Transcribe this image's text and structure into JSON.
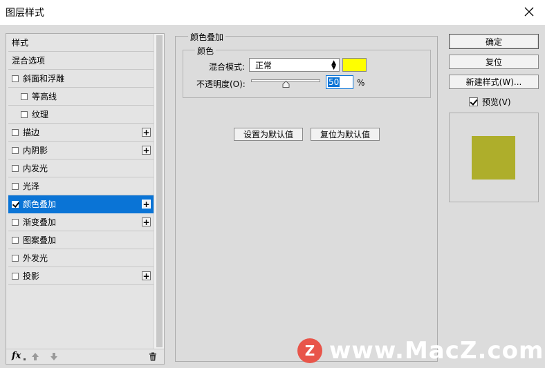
{
  "window": {
    "title": "图层样式"
  },
  "styles": {
    "items": [
      {
        "label": "样式",
        "checkbox": false,
        "checked": false,
        "plus": false,
        "indent": 0,
        "selected": false
      },
      {
        "label": "混合选项",
        "checkbox": false,
        "checked": false,
        "plus": false,
        "indent": 0,
        "selected": false
      },
      {
        "label": "斜面和浮雕",
        "checkbox": true,
        "checked": false,
        "plus": false,
        "indent": 0,
        "selected": false
      },
      {
        "label": "等高线",
        "checkbox": true,
        "checked": false,
        "plus": false,
        "indent": 1,
        "selected": false
      },
      {
        "label": "纹理",
        "checkbox": true,
        "checked": false,
        "plus": false,
        "indent": 1,
        "selected": false
      },
      {
        "label": "描边",
        "checkbox": true,
        "checked": false,
        "plus": true,
        "indent": 0,
        "selected": false
      },
      {
        "label": "内阴影",
        "checkbox": true,
        "checked": false,
        "plus": true,
        "indent": 0,
        "selected": false
      },
      {
        "label": "内发光",
        "checkbox": true,
        "checked": false,
        "plus": false,
        "indent": 0,
        "selected": false
      },
      {
        "label": "光泽",
        "checkbox": true,
        "checked": false,
        "plus": false,
        "indent": 0,
        "selected": false
      },
      {
        "label": "颜色叠加",
        "checkbox": true,
        "checked": true,
        "plus": true,
        "indent": 0,
        "selected": true
      },
      {
        "label": "渐变叠加",
        "checkbox": true,
        "checked": false,
        "plus": true,
        "indent": 0,
        "selected": false
      },
      {
        "label": "图案叠加",
        "checkbox": true,
        "checked": false,
        "plus": false,
        "indent": 0,
        "selected": false
      },
      {
        "label": "外发光",
        "checkbox": true,
        "checked": false,
        "plus": false,
        "indent": 0,
        "selected": false
      },
      {
        "label": "投影",
        "checkbox": true,
        "checked": false,
        "plus": true,
        "indent": 0,
        "selected": false
      }
    ],
    "footer_icons": [
      "fx-icon",
      "arrow-up-icon",
      "arrow-down-icon",
      "trash-icon"
    ],
    "fx_label": "fx"
  },
  "color_overlay": {
    "section_title": "颜色叠加",
    "group_title": "颜色",
    "blend_mode_label": "混合模式:",
    "blend_mode_value": "正常",
    "overlay_color": "#ffff00",
    "opacity_label": "不透明度(O):",
    "opacity_value": "50",
    "opacity_percent": 50,
    "opacity_unit": "%",
    "set_default_label": "设置为默认值",
    "reset_default_label": "复位为默认值"
  },
  "actions": {
    "ok_label": "确定",
    "reset_label": "复位",
    "new_style_label": "新建样式(W)...",
    "preview_label": "预览(V)",
    "preview_checked": true
  },
  "preview": {
    "swatch_color": "#aeae2b"
  },
  "watermark": {
    "badge": "Z",
    "text": "www.MacZ.com"
  },
  "colors": {
    "selection": "#0a74d6",
    "background": "#dcdcdc"
  }
}
